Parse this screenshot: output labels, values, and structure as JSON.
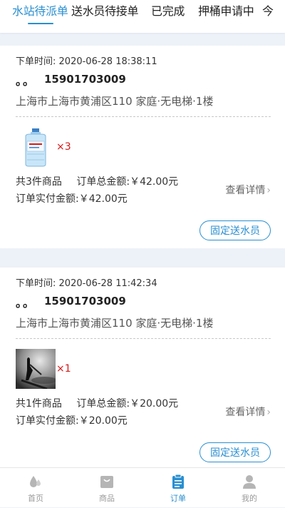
{
  "tabs": [
    {
      "label": "水站待派单",
      "active": true
    },
    {
      "label": "送水员待接单",
      "active": false
    },
    {
      "label": "已完成",
      "active": false
    },
    {
      "label": "押桶申请中",
      "active": false
    },
    {
      "label": "今",
      "active": false
    }
  ],
  "orders": [
    {
      "time_label": "下单时间:",
      "time": "2020-06-28 18:38:11",
      "customer_name": "。。",
      "phone": "15901703009",
      "address": "上海市上海市黄浦区110 家庭·无电梯·1楼",
      "product_icon": "water-bottle-image",
      "quantity": "×3",
      "item_count": "共3件商品",
      "total_label": "订单总金额:",
      "total": "￥42.00元",
      "paid_label": "订单实付金额:",
      "paid": "￥42.00元",
      "detail_label": "查看详情",
      "assign_label": "固定送水员"
    },
    {
      "time_label": "下单时间:",
      "time": "2020-06-28 11:42:34",
      "customer_name": "。。",
      "phone": "15901703009",
      "address": "上海市上海市黄浦区110 家庭·无电梯·1楼",
      "product_icon": "photo-thumbnail-image",
      "quantity": "×1",
      "item_count": "共1件商品",
      "total_label": "订单总金额:",
      "total": "￥20.00元",
      "paid_label": "订单实付金额:",
      "paid": "￥20.00元",
      "detail_label": "查看详情",
      "assign_label": "固定送水员"
    }
  ],
  "bottom_nav": [
    {
      "label": "首页",
      "icon": "water-drop-icon",
      "active": false
    },
    {
      "label": "商品",
      "icon": "shopping-bag-icon",
      "active": false
    },
    {
      "label": "订单",
      "icon": "clipboard-icon",
      "active": true
    },
    {
      "label": "我的",
      "icon": "user-icon",
      "active": false
    }
  ],
  "colors": {
    "accent": "#2a8fd0",
    "price_red": "#d11b1b",
    "background": "#edf1f8"
  }
}
